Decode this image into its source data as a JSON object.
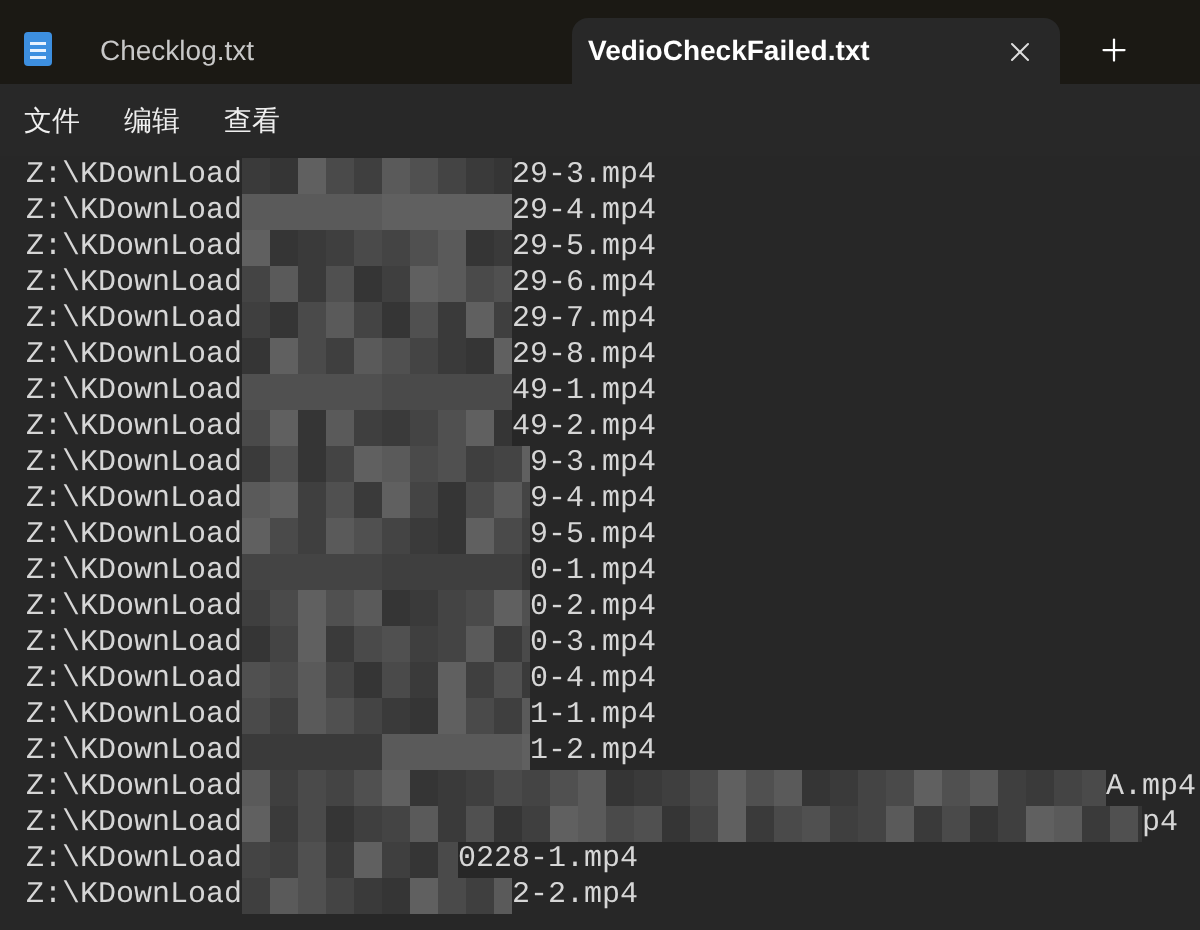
{
  "tabs": [
    {
      "label": "Checklog.txt",
      "selected": false
    },
    {
      "label": "VedioCheckFailed.txt",
      "selected": true
    }
  ],
  "menu": [
    "文件",
    "编辑",
    "查看"
  ],
  "lines": [
    {
      "prefix": "Z:\\KDownLoad",
      "suffix": "29-3.mp4"
    },
    {
      "prefix": "Z:\\KDownLoad",
      "suffix": "29-4.mp4"
    },
    {
      "prefix": "Z:\\KDownLoad",
      "suffix": "29-5.mp4"
    },
    {
      "prefix": "Z:\\KDownLoad",
      "suffix": "29-6.mp4"
    },
    {
      "prefix": "Z:\\KDownLoad",
      "suffix": "29-7.mp4"
    },
    {
      "prefix": "Z:\\KDownLoad",
      "suffix": "29-8.mp4"
    },
    {
      "prefix": "Z:\\KDownLoad",
      "suffix": "49-1.mp4"
    },
    {
      "prefix": "Z:\\KDownLoad",
      "suffix": "49-2.mp4"
    },
    {
      "prefix": "Z:\\KDownLoad",
      "suffix": "9-3.mp4"
    },
    {
      "prefix": "Z:\\KDownLoad",
      "suffix": "9-4.mp4"
    },
    {
      "prefix": "Z:\\KDownLoad",
      "suffix": "9-5.mp4"
    },
    {
      "prefix": "Z:\\KDownLoad",
      "suffix": "0-1.mp4"
    },
    {
      "prefix": "Z:\\KDownLoad",
      "suffix": "0-2.mp4"
    },
    {
      "prefix": "Z:\\KDownLoad",
      "suffix": "0-3.mp4"
    },
    {
      "prefix": "Z:\\KDownLoad",
      "suffix": "0-4.mp4"
    },
    {
      "prefix": "Z:\\KDownLoad",
      "suffix": "1-1.mp4"
    },
    {
      "prefix": "Z:\\KDownLoad",
      "suffix": "1-2.mp4"
    },
    {
      "prefix": "Z:\\KDownLoad",
      "suffix": "A.mp4"
    },
    {
      "prefix": "Z:\\KDownLoad",
      "suffix": "p4"
    },
    {
      "prefix": "Z:\\KDownLoad",
      "suffix": "0228-1.mp4"
    },
    {
      "prefix": "Z:\\KDownLoad",
      "suffix": "2-2.mp4"
    }
  ]
}
